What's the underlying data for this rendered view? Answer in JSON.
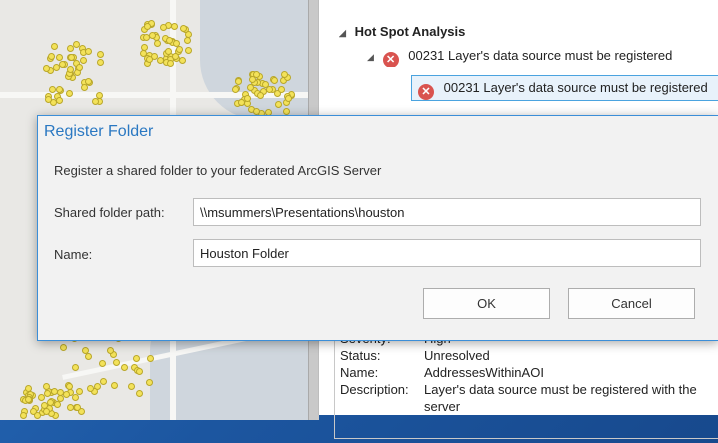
{
  "dialog": {
    "title": "Register Folder",
    "description": "Register a shared folder to your federated ArcGIS Server",
    "shared_folder_path_label": "Shared folder path:",
    "shared_folder_path_value": "\\\\msummers\\Presentations\\houston",
    "name_label": "Name:",
    "name_value": "Houston Folder",
    "ok_label": "OK",
    "cancel_label": "Cancel"
  },
  "results": {
    "group_label": "Hot Spot Analysis",
    "error_item_label": "00231 Layer's data source must be registered",
    "error_child_label": "00231 Layer's data source must be registered",
    "details": {
      "severity_key": "Severity:",
      "severity_value": "High",
      "status_key": "Status:",
      "status_value": "Unresolved",
      "name_key": "Name:",
      "name_value": "AddressesWithinAOI",
      "description_key": "Description:",
      "description_value": "Layer's data source must be registered with the server"
    }
  },
  "colors": {
    "accent": "#2a78c2",
    "error": "#d9534f",
    "map_point": "#f3e25a",
    "desktop": "#1f5fa8"
  },
  "icons": {
    "error": "error-x-icon",
    "expand": "triangle-expanded-icon"
  }
}
